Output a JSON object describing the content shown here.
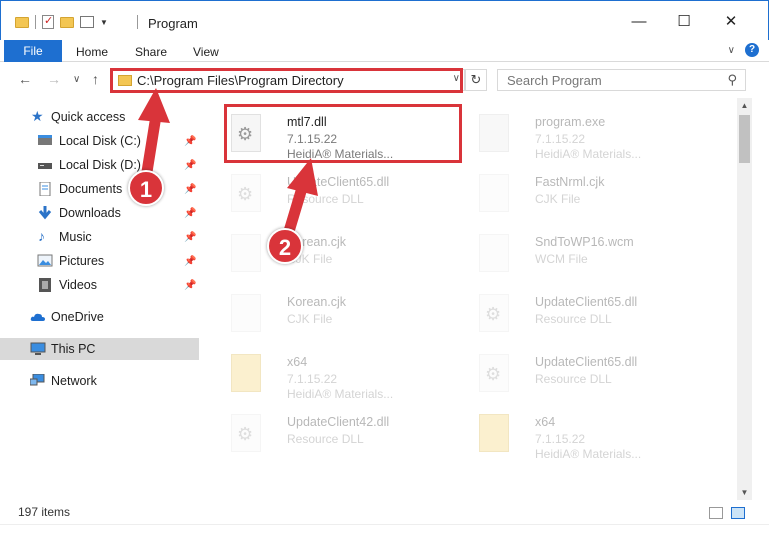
{
  "window": {
    "title": "Program",
    "minimize_glyph": "—",
    "maximize_glyph": "☐",
    "close_glyph": "✕"
  },
  "ribbon": {
    "file_label": "File",
    "tabs": [
      "Home",
      "Share",
      "View"
    ],
    "help_glyph": "?"
  },
  "address": {
    "path": "C:\\Program Files\\Program Directory",
    "search_placeholder": "Search Program",
    "back_glyph": "←",
    "forward_glyph": "→",
    "recent_glyph": "∨",
    "up_glyph": "↑",
    "refresh_glyph": "↻",
    "search_glyph": "⚲"
  },
  "sidebar": {
    "items": [
      {
        "label": "Quick access",
        "icon": "star-icon",
        "pinned": false
      },
      {
        "label": "Local Disk (C:)",
        "icon": "drive-icon",
        "pinned": true
      },
      {
        "label": "Local Disk (D:)",
        "icon": "drive-icon",
        "pinned": true
      },
      {
        "label": "Documents",
        "icon": "documents-icon",
        "pinned": true
      },
      {
        "label": "Downloads",
        "icon": "download-icon",
        "pinned": true
      },
      {
        "label": "Music",
        "icon": "music-icon",
        "pinned": true
      },
      {
        "label": "Pictures",
        "icon": "pictures-icon",
        "pinned": true
      },
      {
        "label": "Videos",
        "icon": "videos-icon",
        "pinned": true
      },
      {
        "label": "OneDrive",
        "icon": "cloud-icon",
        "pinned": false
      },
      {
        "label": "This PC",
        "icon": "computer-icon",
        "pinned": false,
        "selected": true
      },
      {
        "label": "Network",
        "icon": "network-icon",
        "pinned": false
      }
    ]
  },
  "files": [
    {
      "name": "mtl7.dll",
      "line1": "7.1.15.22",
      "line2": "HeidiA® Materials...",
      "icon": "gear-file-icon",
      "highlight": true
    },
    {
      "name": "program.exe",
      "line1": "7.1.15.22",
      "line2": "HeidiA® Materials...",
      "icon": "exe-icon"
    },
    {
      "name": "UpdateClient65.dll",
      "line1": "Resource DLL",
      "line2": "",
      "icon": "gear-file-icon"
    },
    {
      "name": "FastNrml.cjk",
      "line1": "CJK File",
      "line2": "",
      "icon": "blank-file-icon"
    },
    {
      "name": "Korean.cjk",
      "line1": "CJK File",
      "line2": "",
      "icon": "blank-file-icon"
    },
    {
      "name": "SndToWP16.wcm",
      "line1": "WCM File",
      "line2": "",
      "icon": "blank-file-icon"
    },
    {
      "name": "Korean.cjk",
      "line1": "CJK File",
      "line2": "",
      "icon": "blank-file-icon"
    },
    {
      "name": "UpdateClient65.dll",
      "line1": "Resource DLL",
      "line2": "",
      "icon": "gear-file-icon"
    },
    {
      "name": "x64",
      "line1": "7.1.15.22",
      "line2": "HeidiA® Materials...",
      "icon": "folder-file-icon"
    },
    {
      "name": "UpdateClient65.dll",
      "line1": "Resource DLL",
      "line2": "",
      "icon": "gear-file-icon"
    },
    {
      "name": "UpdateClient42.dll",
      "line1": "Resource DLL",
      "line2": "",
      "icon": "gear-file-icon"
    },
    {
      "name": "x64",
      "line1": "7.1.15.22",
      "line2": "HeidiA® Materials...",
      "icon": "folder-file-icon"
    }
  ],
  "status": {
    "count": "197 items"
  },
  "callouts": [
    "1",
    "2"
  ],
  "colors": {
    "accent": "#1e6fd0",
    "annotation_red": "#d9343a"
  }
}
